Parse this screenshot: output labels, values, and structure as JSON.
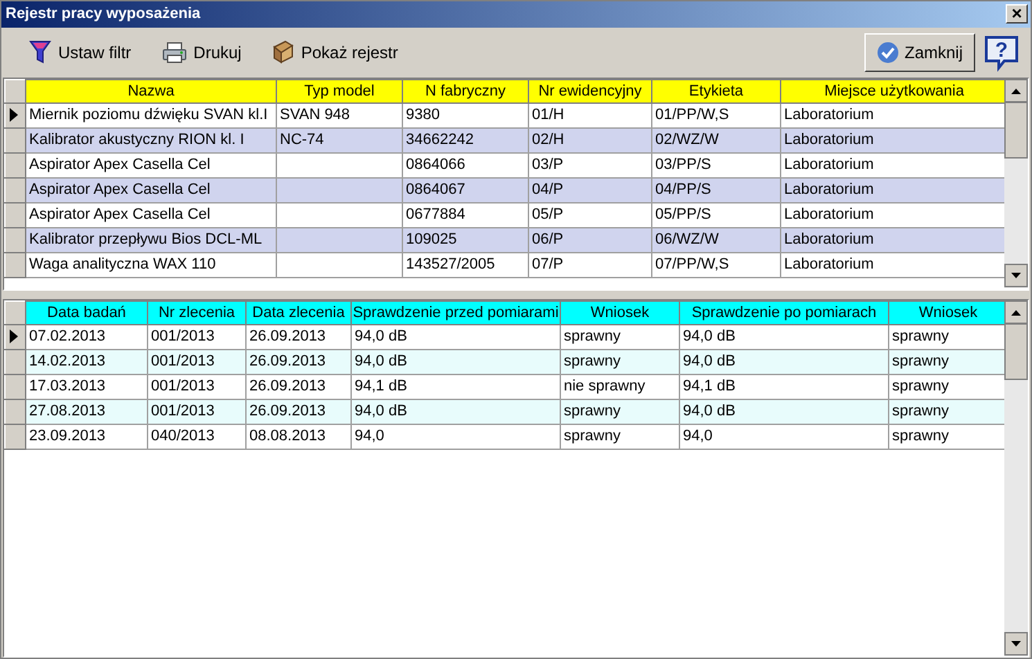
{
  "window": {
    "title": "Rejestr pracy wyposażenia",
    "close_glyph": "×"
  },
  "toolbar": [
    {
      "kind": "filter",
      "label": "Ustaw filtr"
    },
    {
      "kind": "print",
      "label": "Drukuj"
    },
    {
      "kind": "register",
      "label": "Pokaż rejestr"
    }
  ],
  "close_button": {
    "label": "Zamknij"
  },
  "help_glyph": "?",
  "equipment_table": {
    "columns": [
      "Nazwa",
      "Typ model",
      "N fabryczny",
      "Nr ewidencyjny",
      "Etykieta",
      "Miejsce użytkowania"
    ],
    "rows": [
      {
        "selected": true,
        "cells": [
          "Miernik poziomu dźwięku SVAN kl.I",
          "SVAN 948",
          "9380",
          "01/H",
          "01/PP/W,S",
          "Laboratorium"
        ]
      },
      {
        "selected": false,
        "cells": [
          "Kalibrator akustyczny RION kl. I",
          "NC-74",
          "34662242",
          "02/H",
          "02/WZ/W",
          "Laboratorium"
        ]
      },
      {
        "selected": false,
        "cells": [
          "Aspirator Apex Casella Cel",
          "",
          "0864066",
          "03/P",
          "03/PP/S",
          "Laboratorium"
        ]
      },
      {
        "selected": false,
        "cells": [
          "Aspirator Apex Casella Cel",
          "",
          "0864067",
          "04/P",
          "04/PP/S",
          "Laboratorium"
        ]
      },
      {
        "selected": false,
        "cells": [
          "Aspirator Apex Casella Cel",
          "",
          "0677884",
          "05/P",
          "05/PP/S",
          "Laboratorium"
        ]
      },
      {
        "selected": false,
        "cells": [
          "Kalibrator przepływu Bios DCL-ML",
          "",
          "109025",
          "06/P",
          "06/WZ/W",
          "Laboratorium"
        ]
      },
      {
        "selected": false,
        "cells": [
          "Waga analityczna WAX 110",
          "",
          "143527/2005",
          "07/P",
          "07/PP/W,S",
          "Laboratorium"
        ]
      }
    ]
  },
  "checks_table": {
    "columns": [
      "Data badań",
      "Nr zlecenia",
      "Data zlecenia",
      "Sprawdzenie przed pomiarami",
      "Wniosek",
      "Sprawdzenie po pomiarach",
      "Wniosek"
    ],
    "rows": [
      {
        "selected": true,
        "cells": [
          "07.02.2013",
          "001/2013",
          "26.09.2013",
          "94,0 dB",
          "sprawny",
          "94,0 dB",
          "sprawny"
        ]
      },
      {
        "selected": false,
        "cells": [
          "14.02.2013",
          "001/2013",
          "26.09.2013",
          "94,0 dB",
          "sprawny",
          "94,0 dB",
          "sprawny"
        ]
      },
      {
        "selected": false,
        "cells": [
          "17.03.2013",
          "001/2013",
          "26.09.2013",
          "94,1 dB",
          "nie sprawny",
          "94,1 dB",
          "sprawny"
        ]
      },
      {
        "selected": false,
        "cells": [
          "27.08.2013",
          "001/2013",
          "26.09.2013",
          "94,0 dB",
          "sprawny",
          "94,0 dB",
          "sprawny"
        ]
      },
      {
        "selected": false,
        "cells": [
          "23.09.2013",
          "040/2013",
          "08.08.2013",
          "94,0",
          "sprawny",
          "94,0",
          "sprawny"
        ]
      }
    ]
  }
}
